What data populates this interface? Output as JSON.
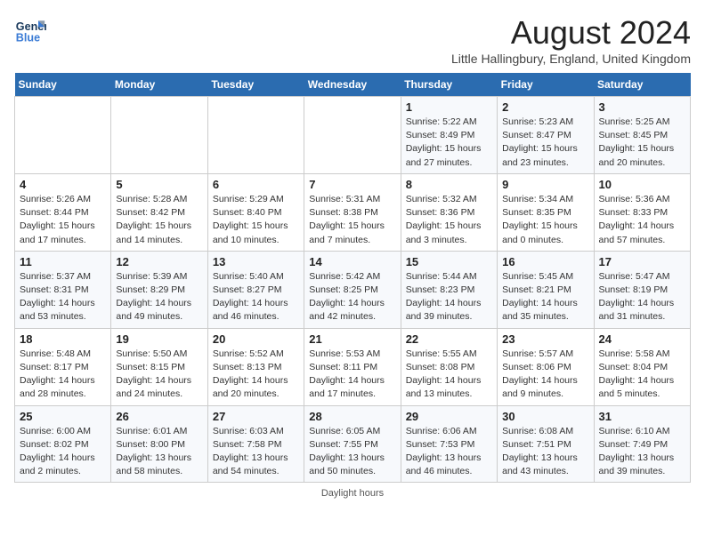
{
  "logo": {
    "line1": "General",
    "line2": "Blue"
  },
  "title": "August 2024",
  "location": "Little Hallingbury, England, United Kingdom",
  "days_header": [
    "Sunday",
    "Monday",
    "Tuesday",
    "Wednesday",
    "Thursday",
    "Friday",
    "Saturday"
  ],
  "weeks": [
    [
      {
        "day": "",
        "info": ""
      },
      {
        "day": "",
        "info": ""
      },
      {
        "day": "",
        "info": ""
      },
      {
        "day": "",
        "info": ""
      },
      {
        "day": "1",
        "info": "Sunrise: 5:22 AM\nSunset: 8:49 PM\nDaylight: 15 hours\nand 27 minutes."
      },
      {
        "day": "2",
        "info": "Sunrise: 5:23 AM\nSunset: 8:47 PM\nDaylight: 15 hours\nand 23 minutes."
      },
      {
        "day": "3",
        "info": "Sunrise: 5:25 AM\nSunset: 8:45 PM\nDaylight: 15 hours\nand 20 minutes."
      }
    ],
    [
      {
        "day": "4",
        "info": "Sunrise: 5:26 AM\nSunset: 8:44 PM\nDaylight: 15 hours\nand 17 minutes."
      },
      {
        "day": "5",
        "info": "Sunrise: 5:28 AM\nSunset: 8:42 PM\nDaylight: 15 hours\nand 14 minutes."
      },
      {
        "day": "6",
        "info": "Sunrise: 5:29 AM\nSunset: 8:40 PM\nDaylight: 15 hours\nand 10 minutes."
      },
      {
        "day": "7",
        "info": "Sunrise: 5:31 AM\nSunset: 8:38 PM\nDaylight: 15 hours\nand 7 minutes."
      },
      {
        "day": "8",
        "info": "Sunrise: 5:32 AM\nSunset: 8:36 PM\nDaylight: 15 hours\nand 3 minutes."
      },
      {
        "day": "9",
        "info": "Sunrise: 5:34 AM\nSunset: 8:35 PM\nDaylight: 15 hours\nand 0 minutes."
      },
      {
        "day": "10",
        "info": "Sunrise: 5:36 AM\nSunset: 8:33 PM\nDaylight: 14 hours\nand 57 minutes."
      }
    ],
    [
      {
        "day": "11",
        "info": "Sunrise: 5:37 AM\nSunset: 8:31 PM\nDaylight: 14 hours\nand 53 minutes."
      },
      {
        "day": "12",
        "info": "Sunrise: 5:39 AM\nSunset: 8:29 PM\nDaylight: 14 hours\nand 49 minutes."
      },
      {
        "day": "13",
        "info": "Sunrise: 5:40 AM\nSunset: 8:27 PM\nDaylight: 14 hours\nand 46 minutes."
      },
      {
        "day": "14",
        "info": "Sunrise: 5:42 AM\nSunset: 8:25 PM\nDaylight: 14 hours\nand 42 minutes."
      },
      {
        "day": "15",
        "info": "Sunrise: 5:44 AM\nSunset: 8:23 PM\nDaylight: 14 hours\nand 39 minutes."
      },
      {
        "day": "16",
        "info": "Sunrise: 5:45 AM\nSunset: 8:21 PM\nDaylight: 14 hours\nand 35 minutes."
      },
      {
        "day": "17",
        "info": "Sunrise: 5:47 AM\nSunset: 8:19 PM\nDaylight: 14 hours\nand 31 minutes."
      }
    ],
    [
      {
        "day": "18",
        "info": "Sunrise: 5:48 AM\nSunset: 8:17 PM\nDaylight: 14 hours\nand 28 minutes."
      },
      {
        "day": "19",
        "info": "Sunrise: 5:50 AM\nSunset: 8:15 PM\nDaylight: 14 hours\nand 24 minutes."
      },
      {
        "day": "20",
        "info": "Sunrise: 5:52 AM\nSunset: 8:13 PM\nDaylight: 14 hours\nand 20 minutes."
      },
      {
        "day": "21",
        "info": "Sunrise: 5:53 AM\nSunset: 8:11 PM\nDaylight: 14 hours\nand 17 minutes."
      },
      {
        "day": "22",
        "info": "Sunrise: 5:55 AM\nSunset: 8:08 PM\nDaylight: 14 hours\nand 13 minutes."
      },
      {
        "day": "23",
        "info": "Sunrise: 5:57 AM\nSunset: 8:06 PM\nDaylight: 14 hours\nand 9 minutes."
      },
      {
        "day": "24",
        "info": "Sunrise: 5:58 AM\nSunset: 8:04 PM\nDaylight: 14 hours\nand 5 minutes."
      }
    ],
    [
      {
        "day": "25",
        "info": "Sunrise: 6:00 AM\nSunset: 8:02 PM\nDaylight: 14 hours\nand 2 minutes."
      },
      {
        "day": "26",
        "info": "Sunrise: 6:01 AM\nSunset: 8:00 PM\nDaylight: 13 hours\nand 58 minutes."
      },
      {
        "day": "27",
        "info": "Sunrise: 6:03 AM\nSunset: 7:58 PM\nDaylight: 13 hours\nand 54 minutes."
      },
      {
        "day": "28",
        "info": "Sunrise: 6:05 AM\nSunset: 7:55 PM\nDaylight: 13 hours\nand 50 minutes."
      },
      {
        "day": "29",
        "info": "Sunrise: 6:06 AM\nSunset: 7:53 PM\nDaylight: 13 hours\nand 46 minutes."
      },
      {
        "day": "30",
        "info": "Sunrise: 6:08 AM\nSunset: 7:51 PM\nDaylight: 13 hours\nand 43 minutes."
      },
      {
        "day": "31",
        "info": "Sunrise: 6:10 AM\nSunset: 7:49 PM\nDaylight: 13 hours\nand 39 minutes."
      }
    ]
  ],
  "footer": "Daylight hours"
}
